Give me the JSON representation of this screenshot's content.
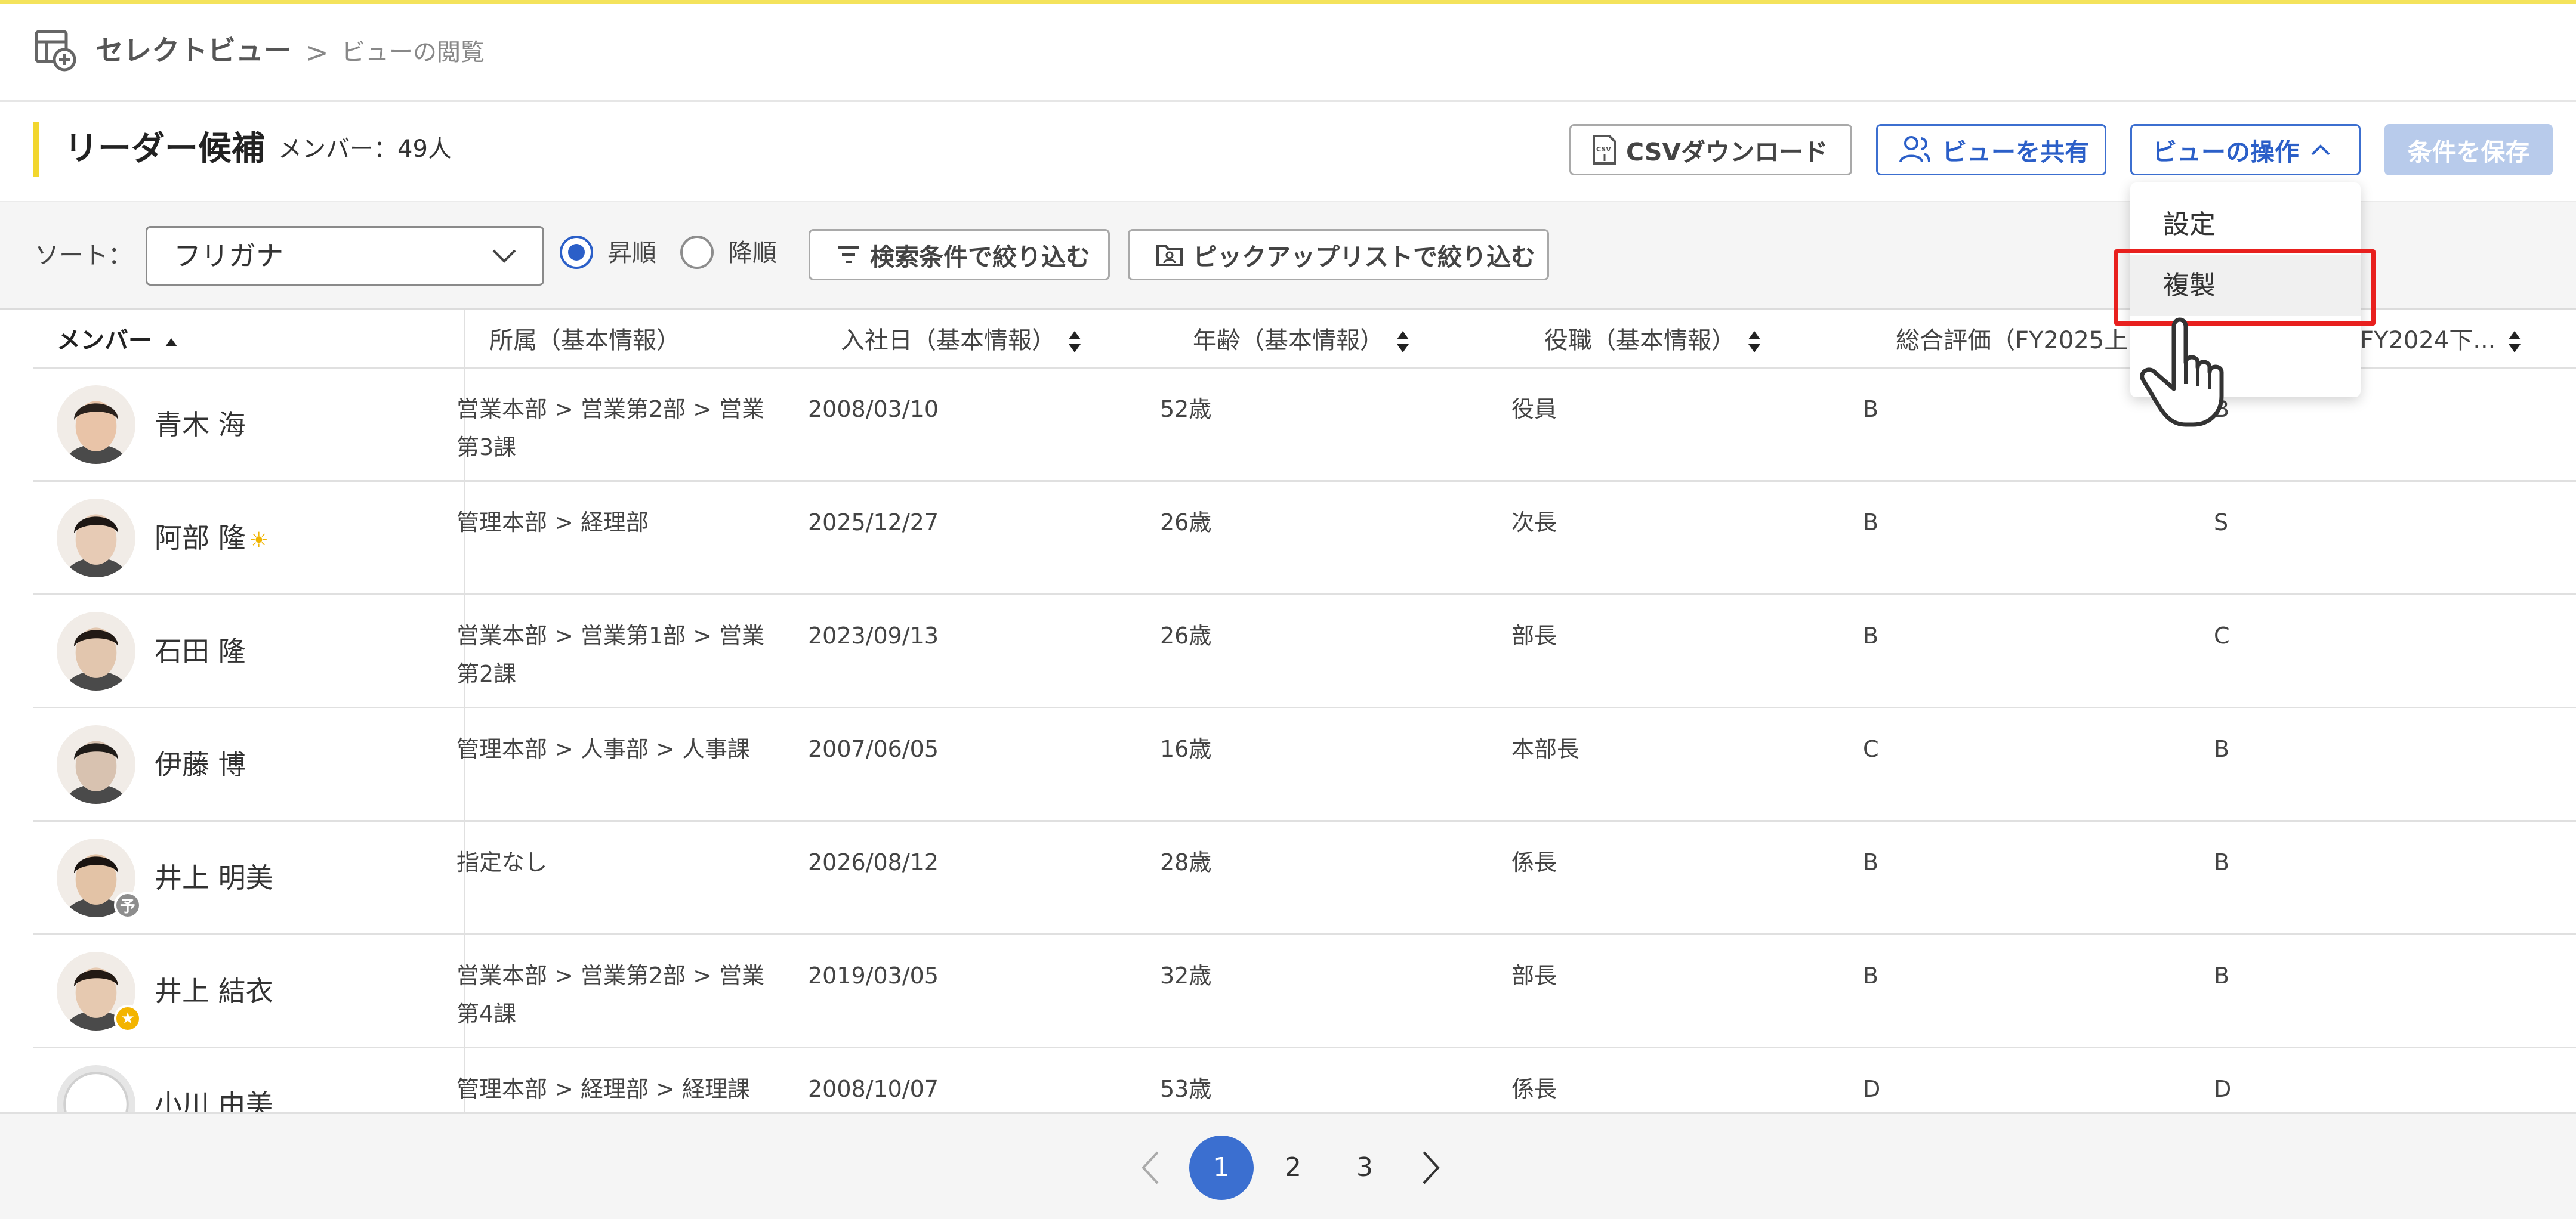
{
  "header": {
    "app_title": "セレクトビュー",
    "separator": ">",
    "breadcrumb_current": "ビューの閲覧"
  },
  "titlebar": {
    "page_title": "リーダー候補",
    "member_count": "メンバー：49人",
    "csv_label": "CSVダウンロード",
    "share_label": "ビューを共有",
    "view_ops_label": "ビューの操作",
    "save_label": "条件を保存"
  },
  "toolbar": {
    "sort_label": "ソート：",
    "sort_value": "フリガナ",
    "asc_label": "昇順",
    "desc_label": "降順",
    "sort_order": "asc",
    "filter_search_label": "検索条件で絞り込む",
    "filter_pick_label": "ピックアップリストで絞り込む"
  },
  "table": {
    "headers": [
      "メンバー",
      "所属（基本情報）",
      "入社日（基本情報）",
      "年齢（基本情報）",
      "役職（基本情報）",
      "総合評価（FY2025上",
      "（FY2024下..."
    ],
    "rows": [
      {
        "name": "青木 海",
        "dept": "営業本部 > 営業第2部 > 営業第3課",
        "joined": "2008/03/10",
        "age": "52歳",
        "position": "役員",
        "eval1": "B",
        "eval2": "B",
        "badge": ""
      },
      {
        "name": "阿部 隆",
        "dept": "管理本部 > 経理部",
        "joined": "2025/12/27",
        "age": "26歳",
        "position": "次長",
        "eval1": "B",
        "eval2": "S",
        "badge": "sun"
      },
      {
        "name": "石田 隆",
        "dept": "営業本部 > 営業第1部 > 営業第2課",
        "joined": "2023/09/13",
        "age": "26歳",
        "position": "部長",
        "eval1": "B",
        "eval2": "C",
        "badge": ""
      },
      {
        "name": "伊藤 博",
        "dept": "管理本部 > 人事部 > 人事課",
        "joined": "2007/06/05",
        "age": "16歳",
        "position": "本部長",
        "eval1": "C",
        "eval2": "B",
        "badge": ""
      },
      {
        "name": "井上 明美",
        "dept": "指定なし",
        "joined": "2026/08/12",
        "age": "28歳",
        "position": "係長",
        "eval1": "B",
        "eval2": "B",
        "badge": "予"
      },
      {
        "name": "井上 結衣",
        "dept": "営業本部 > 営業第2部 > 営業第4課",
        "joined": "2019/03/05",
        "age": "32歳",
        "position": "部長",
        "eval1": "B",
        "eval2": "B",
        "badge": "★"
      },
      {
        "name": "小川 由美",
        "dept": "管理本部 > 経理部 > 経理課",
        "joined": "2008/10/07",
        "age": "53歳",
        "position": "係長",
        "eval1": "D",
        "eval2": "D",
        "badge": ""
      }
    ]
  },
  "dropdown": {
    "settings_label": "設定",
    "duplicate_label": "複製"
  },
  "pagination": {
    "pages": [
      "1",
      "2",
      "3"
    ],
    "current": "1"
  },
  "colors": {
    "accent": "#f2d62e",
    "primary": "#3b6fd0",
    "highlight": "#e8201e"
  }
}
